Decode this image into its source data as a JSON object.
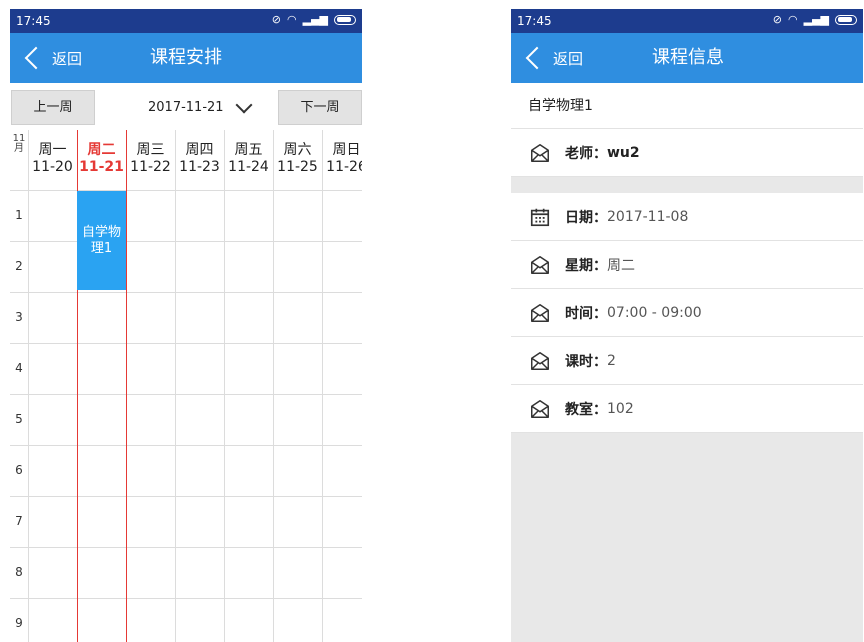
{
  "left_screen": {
    "status_bar": {
      "time": "17:45"
    },
    "nav": {
      "back_label": "返回",
      "title": "课程安排"
    },
    "toolbar": {
      "prev_week": "上一周",
      "date": "2017-11-21",
      "next_week": "下一周"
    },
    "grid": {
      "month": "11\n月",
      "days": [
        {
          "name": "周一",
          "date": "11-20"
        },
        {
          "name": "周二",
          "date": "11-21",
          "today": true
        },
        {
          "name": "周三",
          "date": "11-22"
        },
        {
          "name": "周四",
          "date": "11-23"
        },
        {
          "name": "周五",
          "date": "11-24"
        },
        {
          "name": "周六",
          "date": "11-25"
        },
        {
          "name": "周日",
          "date": "11-26"
        }
      ],
      "rows": [
        "1",
        "2",
        "3",
        "4",
        "5",
        "6",
        "7",
        "8",
        "9"
      ],
      "course": {
        "name": "自学物理1",
        "day": "周二",
        "periods": [
          1,
          2
        ]
      }
    }
  },
  "right_screen": {
    "status_bar": {
      "time": "17:45"
    },
    "nav": {
      "back_label": "返回",
      "title": "课程信息"
    },
    "course_name": "自学物理1",
    "teacher": {
      "label": "老师：",
      "value": "wu2"
    },
    "details": [
      {
        "icon": "calendar-icon",
        "label": "日期：",
        "value": "2017-11-08"
      },
      {
        "icon": "teacher-icon",
        "label": "星期：",
        "value": "周二"
      },
      {
        "icon": "teacher-icon",
        "label": "时间：",
        "value": "07:00 - 09:00"
      },
      {
        "icon": "teacher-icon",
        "label": "课时：",
        "value": "2"
      },
      {
        "icon": "teacher-icon",
        "label": "教室：",
        "value": "102"
      }
    ]
  }
}
